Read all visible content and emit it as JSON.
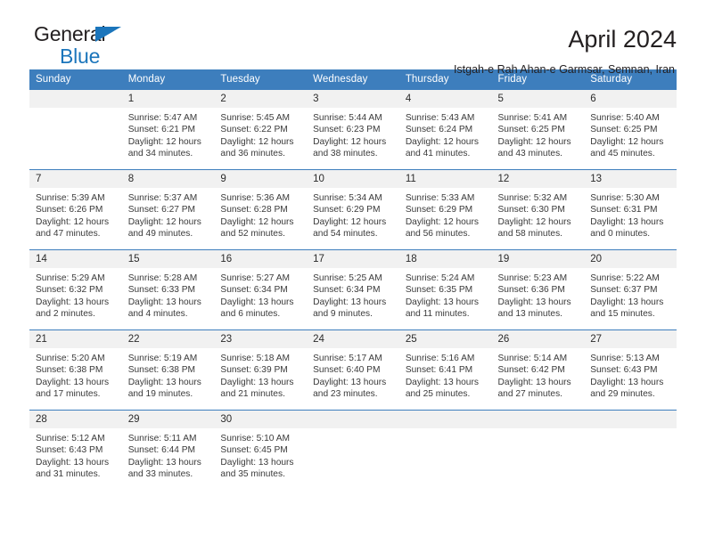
{
  "brand": {
    "line1": "General",
    "line2": "Blue",
    "accent_color": "#1b75bb"
  },
  "header": {
    "title": "April 2024",
    "subtitle": "Istgah-e Rah Ahan-e Garmsar, Semnan, Iran"
  },
  "calendar": {
    "header_color": "#3d7ebd",
    "daynum_bg": "#f1f1f1",
    "weekdays": [
      "Sunday",
      "Monday",
      "Tuesday",
      "Wednesday",
      "Thursday",
      "Friday",
      "Saturday"
    ],
    "weeks": [
      [
        {
          "day": "",
          "lines": []
        },
        {
          "day": "1",
          "lines": [
            "Sunrise: 5:47 AM",
            "Sunset: 6:21 PM",
            "Daylight: 12 hours",
            "and 34 minutes."
          ]
        },
        {
          "day": "2",
          "lines": [
            "Sunrise: 5:45 AM",
            "Sunset: 6:22 PM",
            "Daylight: 12 hours",
            "and 36 minutes."
          ]
        },
        {
          "day": "3",
          "lines": [
            "Sunrise: 5:44 AM",
            "Sunset: 6:23 PM",
            "Daylight: 12 hours",
            "and 38 minutes."
          ]
        },
        {
          "day": "4",
          "lines": [
            "Sunrise: 5:43 AM",
            "Sunset: 6:24 PM",
            "Daylight: 12 hours",
            "and 41 minutes."
          ]
        },
        {
          "day": "5",
          "lines": [
            "Sunrise: 5:41 AM",
            "Sunset: 6:25 PM",
            "Daylight: 12 hours",
            "and 43 minutes."
          ]
        },
        {
          "day": "6",
          "lines": [
            "Sunrise: 5:40 AM",
            "Sunset: 6:25 PM",
            "Daylight: 12 hours",
            "and 45 minutes."
          ]
        }
      ],
      [
        {
          "day": "7",
          "lines": [
            "Sunrise: 5:39 AM",
            "Sunset: 6:26 PM",
            "Daylight: 12 hours",
            "and 47 minutes."
          ]
        },
        {
          "day": "8",
          "lines": [
            "Sunrise: 5:37 AM",
            "Sunset: 6:27 PM",
            "Daylight: 12 hours",
            "and 49 minutes."
          ]
        },
        {
          "day": "9",
          "lines": [
            "Sunrise: 5:36 AM",
            "Sunset: 6:28 PM",
            "Daylight: 12 hours",
            "and 52 minutes."
          ]
        },
        {
          "day": "10",
          "lines": [
            "Sunrise: 5:34 AM",
            "Sunset: 6:29 PM",
            "Daylight: 12 hours",
            "and 54 minutes."
          ]
        },
        {
          "day": "11",
          "lines": [
            "Sunrise: 5:33 AM",
            "Sunset: 6:29 PM",
            "Daylight: 12 hours",
            "and 56 minutes."
          ]
        },
        {
          "day": "12",
          "lines": [
            "Sunrise: 5:32 AM",
            "Sunset: 6:30 PM",
            "Daylight: 12 hours",
            "and 58 minutes."
          ]
        },
        {
          "day": "13",
          "lines": [
            "Sunrise: 5:30 AM",
            "Sunset: 6:31 PM",
            "Daylight: 13 hours",
            "and 0 minutes."
          ]
        }
      ],
      [
        {
          "day": "14",
          "lines": [
            "Sunrise: 5:29 AM",
            "Sunset: 6:32 PM",
            "Daylight: 13 hours",
            "and 2 minutes."
          ]
        },
        {
          "day": "15",
          "lines": [
            "Sunrise: 5:28 AM",
            "Sunset: 6:33 PM",
            "Daylight: 13 hours",
            "and 4 minutes."
          ]
        },
        {
          "day": "16",
          "lines": [
            "Sunrise: 5:27 AM",
            "Sunset: 6:34 PM",
            "Daylight: 13 hours",
            "and 6 minutes."
          ]
        },
        {
          "day": "17",
          "lines": [
            "Sunrise: 5:25 AM",
            "Sunset: 6:34 PM",
            "Daylight: 13 hours",
            "and 9 minutes."
          ]
        },
        {
          "day": "18",
          "lines": [
            "Sunrise: 5:24 AM",
            "Sunset: 6:35 PM",
            "Daylight: 13 hours",
            "and 11 minutes."
          ]
        },
        {
          "day": "19",
          "lines": [
            "Sunrise: 5:23 AM",
            "Sunset: 6:36 PM",
            "Daylight: 13 hours",
            "and 13 minutes."
          ]
        },
        {
          "day": "20",
          "lines": [
            "Sunrise: 5:22 AM",
            "Sunset: 6:37 PM",
            "Daylight: 13 hours",
            "and 15 minutes."
          ]
        }
      ],
      [
        {
          "day": "21",
          "lines": [
            "Sunrise: 5:20 AM",
            "Sunset: 6:38 PM",
            "Daylight: 13 hours",
            "and 17 minutes."
          ]
        },
        {
          "day": "22",
          "lines": [
            "Sunrise: 5:19 AM",
            "Sunset: 6:38 PM",
            "Daylight: 13 hours",
            "and 19 minutes."
          ]
        },
        {
          "day": "23",
          "lines": [
            "Sunrise: 5:18 AM",
            "Sunset: 6:39 PM",
            "Daylight: 13 hours",
            "and 21 minutes."
          ]
        },
        {
          "day": "24",
          "lines": [
            "Sunrise: 5:17 AM",
            "Sunset: 6:40 PM",
            "Daylight: 13 hours",
            "and 23 minutes."
          ]
        },
        {
          "day": "25",
          "lines": [
            "Sunrise: 5:16 AM",
            "Sunset: 6:41 PM",
            "Daylight: 13 hours",
            "and 25 minutes."
          ]
        },
        {
          "day": "26",
          "lines": [
            "Sunrise: 5:14 AM",
            "Sunset: 6:42 PM",
            "Daylight: 13 hours",
            "and 27 minutes."
          ]
        },
        {
          "day": "27",
          "lines": [
            "Sunrise: 5:13 AM",
            "Sunset: 6:43 PM",
            "Daylight: 13 hours",
            "and 29 minutes."
          ]
        }
      ],
      [
        {
          "day": "28",
          "lines": [
            "Sunrise: 5:12 AM",
            "Sunset: 6:43 PM",
            "Daylight: 13 hours",
            "and 31 minutes."
          ]
        },
        {
          "day": "29",
          "lines": [
            "Sunrise: 5:11 AM",
            "Sunset: 6:44 PM",
            "Daylight: 13 hours",
            "and 33 minutes."
          ]
        },
        {
          "day": "30",
          "lines": [
            "Sunrise: 5:10 AM",
            "Sunset: 6:45 PM",
            "Daylight: 13 hours",
            "and 35 minutes."
          ]
        },
        {
          "day": "",
          "lines": []
        },
        {
          "day": "",
          "lines": []
        },
        {
          "day": "",
          "lines": []
        },
        {
          "day": "",
          "lines": []
        }
      ]
    ]
  }
}
